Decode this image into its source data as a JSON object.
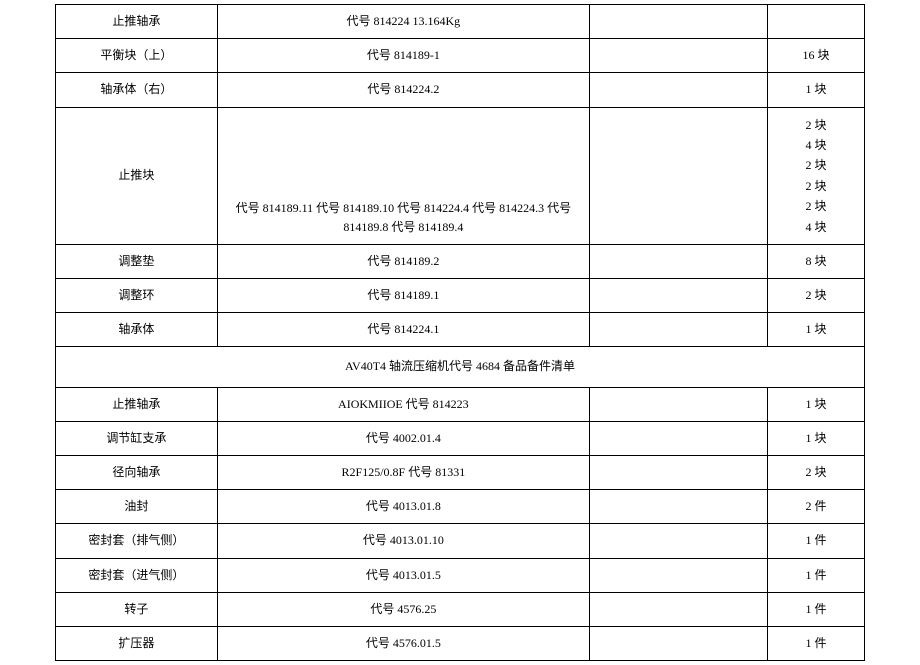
{
  "rows": [
    {
      "c1": "止推轴承",
      "c2": "代号 814224      13.164Kg",
      "c3": "",
      "c4": ""
    },
    {
      "c1": "平衡块（上）",
      "c2": "代号 814189-1",
      "c3": "",
      "c4": "16 块"
    },
    {
      "c1": "轴承体（右）",
      "c2": "代号 814224.2",
      "c3": "",
      "c4": "1 块"
    },
    {
      "c1": "止推块",
      "c2": "代号 814189.11 代号 814189.10 代号 814224.4 代号 814224.3 代号 814189.8 代号 814189.4",
      "c3": "",
      "c4": "2 块\n4 块\n2 块\n2 块\n2 块\n4 块",
      "tallRow": true
    },
    {
      "c1": "调整垫",
      "c2": "代号 814189.2",
      "c3": "",
      "c4": "8 块"
    },
    {
      "c1": "调整环",
      "c2": "代号 814189.1",
      "c3": "",
      "c4": "2 块"
    },
    {
      "c1": "轴承体",
      "c2": "代号 814224.1",
      "c3": "",
      "c4": "1 块"
    },
    {
      "section": "AV40T4 轴流压缩机代号 4684 备品备件清单"
    },
    {
      "c1": "止推轴承",
      "c2": "AIOKMIIOE 代号 814223",
      "c3": "",
      "c4": "1 块"
    },
    {
      "c1": "调节缸支承",
      "c2": "代号 4002.01.4",
      "c3": "",
      "c4": "1 块"
    },
    {
      "c1": "径向轴承",
      "c2": "R2F125/0.8F          代号 81331",
      "c3": "",
      "c4": "2 块"
    },
    {
      "c1": "油封",
      "c2": "代号 4013.01.8",
      "c3": "",
      "c4": "2 件"
    },
    {
      "c1": "密封套（排气侧）",
      "c2": "代号 4013.01.10",
      "c3": "",
      "c4": "1 件"
    },
    {
      "c1": "密封套（进气侧）",
      "c2": "代号 4013.01.5",
      "c3": "",
      "c4": "1 件"
    },
    {
      "c1": "转子",
      "c2": "代号 4576.25",
      "c3": "",
      "c4": "1 件"
    },
    {
      "c1": "扩压器",
      "c2": "代号 4576.01.5",
      "c3": "",
      "c4": "1 件"
    }
  ]
}
